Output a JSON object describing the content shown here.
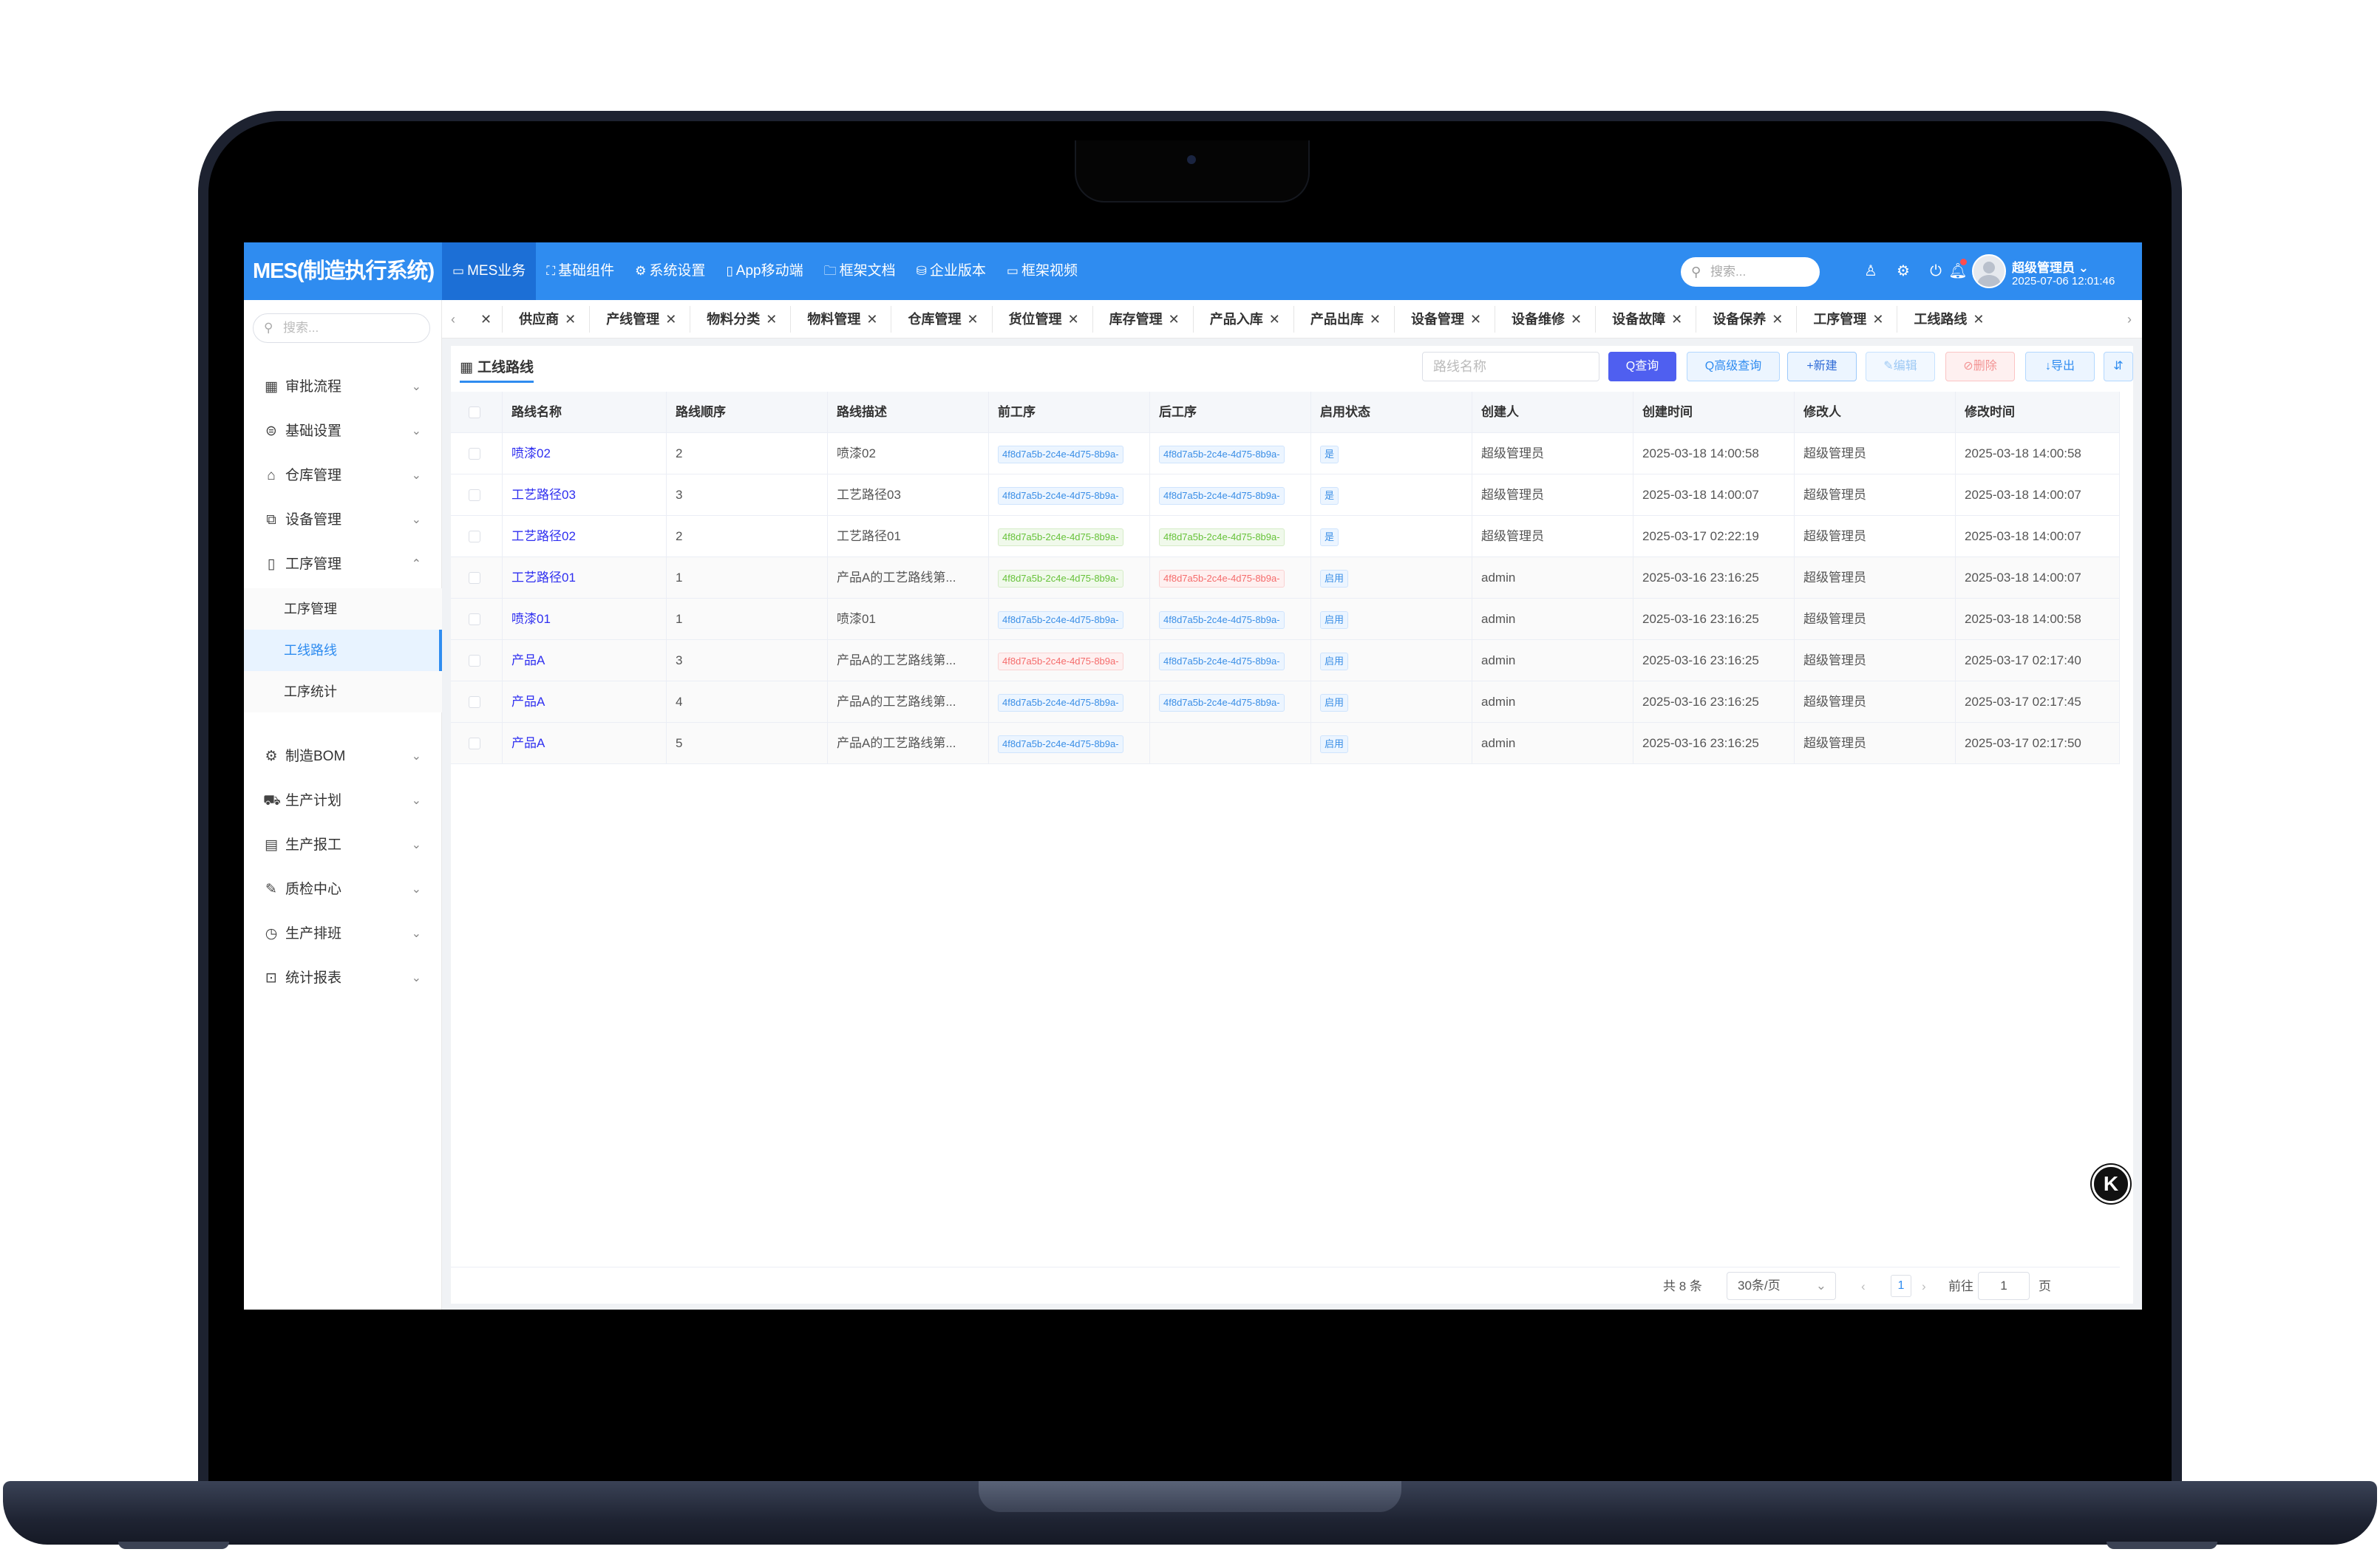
{
  "app": {
    "logo": "MES(制造执行系统)",
    "menu": [
      {
        "icon": "▭",
        "label": "MES业务"
      },
      {
        "icon": "⛶",
        "label": "基础组件"
      },
      {
        "icon": "⚙",
        "label": "系统设置"
      },
      {
        "icon": "▯",
        "label": "App移动端"
      },
      {
        "icon": "🗀",
        "label": "框架文档"
      },
      {
        "icon": "⛁",
        "label": "企业版本"
      },
      {
        "icon": "▭",
        "label": "框架视频"
      }
    ],
    "search_placeholder": "搜索...",
    "user_name": "超级管理员 ⌄",
    "user_time": "2025-07-06 12:01:46"
  },
  "sidebar": {
    "search_placeholder": "搜索...",
    "items": [
      {
        "icon": "▦",
        "label": "审批流程"
      },
      {
        "icon": "⊜",
        "label": "基础设置"
      },
      {
        "icon": "⌂",
        "label": "仓库管理"
      },
      {
        "icon": "⧉",
        "label": "设备管理"
      },
      {
        "icon": "▯",
        "label": "工序管理"
      },
      {
        "icon": "⚙",
        "label": "制造BOM"
      },
      {
        "icon": "⛟",
        "label": "生产计划"
      },
      {
        "icon": "▤",
        "label": "生产报工"
      },
      {
        "icon": "✎",
        "label": "质检中心"
      },
      {
        "icon": "◷",
        "label": "生产排班"
      },
      {
        "icon": "⊡",
        "label": "统计报表"
      }
    ],
    "sub_items": [
      "工序管理",
      "工线路线",
      "工序统计"
    ]
  },
  "tabs": [
    "",
    "供应商",
    "产线管理",
    "物料分类",
    "物料管理",
    "仓库管理",
    "货位管理",
    "库存管理",
    "产品入库",
    "产品出库",
    "设备管理",
    "设备维修",
    "设备故障",
    "设备保养",
    "工序管理",
    "工线路线"
  ],
  "page": {
    "title": "工线路线",
    "filter_placeholder": "路线名称",
    "buttons": {
      "query": "Q查询",
      "advanced": "Q高级查询",
      "new": "+新建",
      "edit": "✎编辑",
      "delete": "⊘删除",
      "export": "↓导出",
      "more": "⇵"
    }
  },
  "table": {
    "columns": [
      "路线名称",
      "路线顺序",
      "路线描述",
      "前工序",
      "后工序",
      "启用状态",
      "创建人",
      "创建时间",
      "修改人",
      "修改时间"
    ],
    "rows": [
      {
        "name": "喷漆02",
        "order": "2",
        "desc": "喷漆02",
        "prev": "4f8d7a5b-2c4e-4d75-8b9a-",
        "prev_color": "blue",
        "next": "4f8d7a5b-2c4e-4d75-8b9a-",
        "next_color": "blue",
        "status": "是",
        "creator": "超级管理员",
        "created": "2025-03-18 14:00:58",
        "modifier": "超级管理员",
        "modified": "2025-03-18 14:00:58"
      },
      {
        "name": "工艺路径03",
        "order": "3",
        "desc": "工艺路径03",
        "prev": "4f8d7a5b-2c4e-4d75-8b9a-",
        "prev_color": "blue",
        "next": "4f8d7a5b-2c4e-4d75-8b9a-",
        "next_color": "blue",
        "status": "是",
        "creator": "超级管理员",
        "created": "2025-03-18 14:00:07",
        "modifier": "超级管理员",
        "modified": "2025-03-18 14:00:07"
      },
      {
        "name": "工艺路径02",
        "order": "2",
        "desc": "工艺路径01",
        "prev": "4f8d7a5b-2c4e-4d75-8b9a-",
        "prev_color": "green",
        "next": "4f8d7a5b-2c4e-4d75-8b9a-",
        "next_color": "green",
        "status": "是",
        "creator": "超级管理员",
        "created": "2025-03-17 02:22:19",
        "modifier": "超级管理员",
        "modified": "2025-03-18 14:00:07"
      },
      {
        "name": "工艺路径01",
        "order": "1",
        "desc": "产品A的工艺路线第...",
        "prev": "4f8d7a5b-2c4e-4d75-8b9a-",
        "prev_color": "green",
        "next": "4f8d7a5b-2c4e-4d75-8b9a-",
        "next_color": "red",
        "status": "启用",
        "creator": "admin",
        "created": "2025-03-16 23:16:25",
        "modifier": "超级管理员",
        "modified": "2025-03-18 14:00:07"
      },
      {
        "name": "喷漆01",
        "order": "1",
        "desc": "喷漆01",
        "prev": "4f8d7a5b-2c4e-4d75-8b9a-",
        "prev_color": "blue",
        "next": "4f8d7a5b-2c4e-4d75-8b9a-",
        "next_color": "blue",
        "status": "启用",
        "creator": "admin",
        "created": "2025-03-16 23:16:25",
        "modifier": "超级管理员",
        "modified": "2025-03-18 14:00:58"
      },
      {
        "name": "产品A",
        "order": "3",
        "desc": "产品A的工艺路线第...",
        "prev": "4f8d7a5b-2c4e-4d75-8b9a-",
        "prev_color": "red",
        "next": "4f8d7a5b-2c4e-4d75-8b9a-",
        "next_color": "blue",
        "status": "启用",
        "creator": "admin",
        "created": "2025-03-16 23:16:25",
        "modifier": "超级管理员",
        "modified": "2025-03-17 02:17:40"
      },
      {
        "name": "产品A",
        "order": "4",
        "desc": "产品A的工艺路线第...",
        "prev": "4f8d7a5b-2c4e-4d75-8b9a-",
        "prev_color": "blue",
        "next": "4f8d7a5b-2c4e-4d75-8b9a-",
        "next_color": "blue",
        "status": "启用",
        "creator": "admin",
        "created": "2025-03-16 23:16:25",
        "modifier": "超级管理员",
        "modified": "2025-03-17 02:17:45"
      },
      {
        "name": "产品A",
        "order": "5",
        "desc": "产品A的工艺路线第...",
        "prev": "4f8d7a5b-2c4e-4d75-8b9a-",
        "prev_color": "blue",
        "next": "",
        "next_color": "",
        "status": "启用",
        "creator": "admin",
        "created": "2025-03-16 23:16:25",
        "modifier": "超级管理员",
        "modified": "2025-03-17 02:17:50"
      }
    ]
  },
  "pagination": {
    "total": "共 8 条",
    "page_size": "30条/页",
    "prev": "‹",
    "current": "1",
    "next": "›",
    "goto_label": "前往",
    "goto_value": "1",
    "page_suffix": "页"
  },
  "float_button": "K",
  "colors": {
    "primary": "#2f8cf0",
    "query_button": "#4f5ff0",
    "link": "#2f2ff0"
  }
}
